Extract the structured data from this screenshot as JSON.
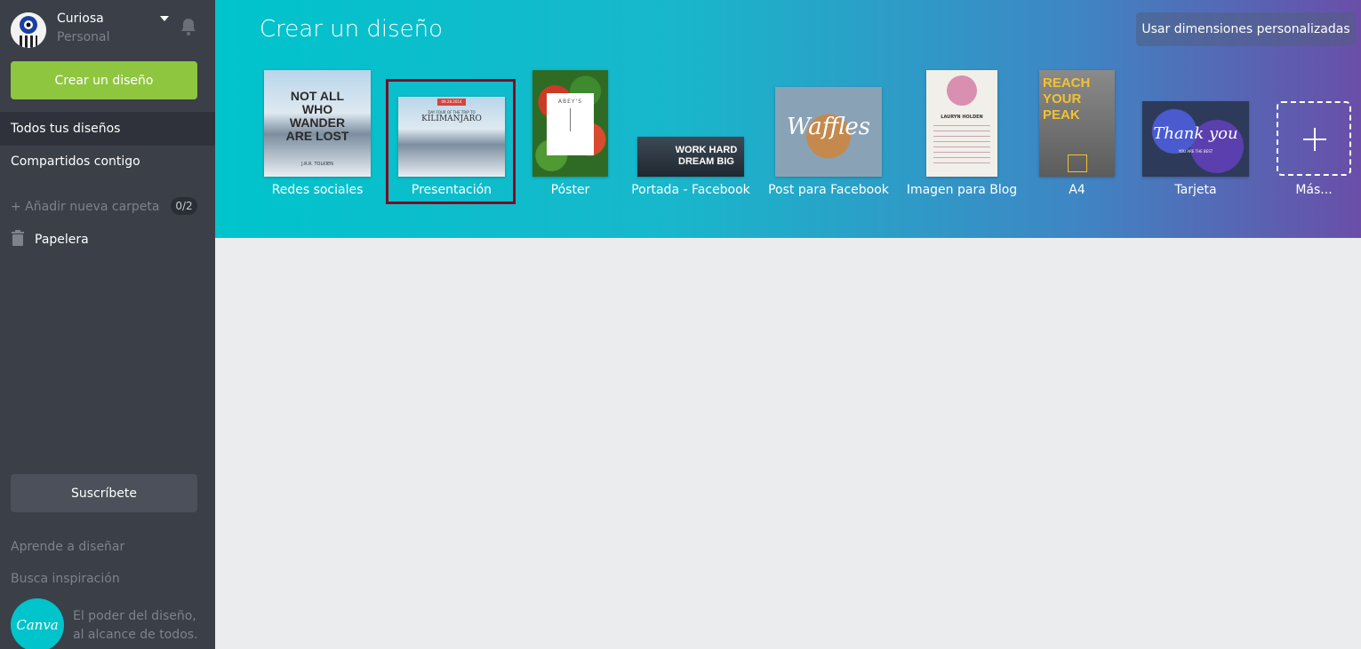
{
  "user": {
    "name": "Curiosa",
    "plan": "Personal"
  },
  "sidebar": {
    "create_label": "Crear un diseño",
    "all_designs_label": "Todos tus diseños",
    "shared_label": "Compartidos contigo",
    "add_folder_label": "+ Añadir nueva carpeta",
    "folder_count": "0/2",
    "trash_label": "Papelera",
    "subscribe_label": "Suscríbete",
    "learn_label": "Aprende a diseñar",
    "inspiration_label": "Busca inspiración",
    "tagline_line1": "El poder del diseño,",
    "tagline_line2": "al alcance de todos.",
    "logo_text": "Canva"
  },
  "header": {
    "title": "Crear un diseño",
    "custom_dims_label": "Usar dimensiones personalizadas"
  },
  "templates": [
    {
      "label": "Redes sociales",
      "thumb_text": "NOT ALL WHO WANDER ARE LOST",
      "thumb_sub": "J.R.R. TOLKIEN"
    },
    {
      "label": "Presentación",
      "thumb_text": "KILIMANJARO",
      "thumb_sub": "DAY FOUR OF THE TRIP TO",
      "thumb_date": "09.28.2014"
    },
    {
      "label": "Póster",
      "thumb_text": "ABEY'S"
    },
    {
      "label": "Portada - Facebook",
      "thumb_text": "WORK HARD DREAM BIG"
    },
    {
      "label": "Post para Facebook",
      "thumb_text": "Waffles"
    },
    {
      "label": "Imagen para Blog",
      "thumb_text": "LAURYN HOLDEN"
    },
    {
      "label": "A4",
      "thumb_text": "REACH YOUR PEAK"
    },
    {
      "label": "Tarjeta",
      "thumb_text": "Thank you",
      "thumb_sub": "YOU ARE THE BEST"
    },
    {
      "label": "Más..."
    }
  ],
  "colors": {
    "accent_green": "#8ec63f",
    "sidebar": "#3b3f48",
    "highlight": "#7c0c23"
  },
  "icons": {
    "bell": "bell-icon",
    "trash": "trash-icon",
    "dropdown": "chevron-down-icon",
    "plus": "plus-icon"
  }
}
